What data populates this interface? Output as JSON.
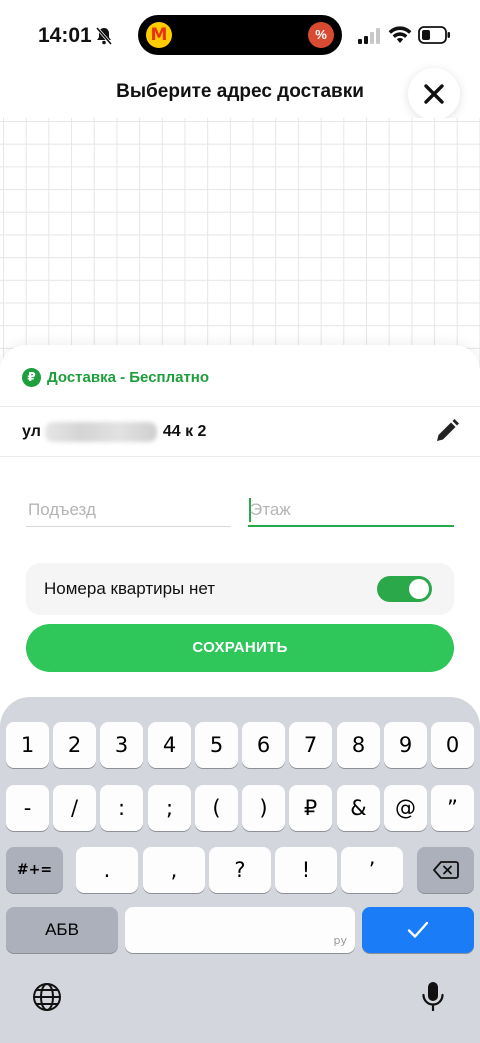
{
  "status_bar": {
    "time": "14:01"
  },
  "header": {
    "title": "Выберите адрес доставки"
  },
  "sheet": {
    "delivery_label": "Доставка - Бесплатно",
    "address_prefix": "ул",
    "address_suffix": "44 к 2",
    "entrance_placeholder": "Подъезд",
    "floor_placeholder": "Этаж",
    "no_apartment_label": "Номера квартиры нет",
    "no_apartment_enabled": true,
    "save_label": "СОХРАНИТЬ"
  },
  "keyboard": {
    "row1": [
      "1",
      "2",
      "3",
      "4",
      "5",
      "6",
      "7",
      "8",
      "9",
      "0"
    ],
    "row2": [
      "-",
      "/",
      ":",
      ";",
      "(",
      ")",
      "₽",
      "&",
      "@",
      "”"
    ],
    "row3": [
      "#+=",
      ".",
      ",",
      "?",
      "!",
      "’"
    ],
    "abc_label": "АБВ",
    "space_lang": "ру"
  },
  "colors": {
    "accent_green": "#2fc75a",
    "delivery_green": "#1e9e3c",
    "return_blue": "#1a7cf7"
  }
}
